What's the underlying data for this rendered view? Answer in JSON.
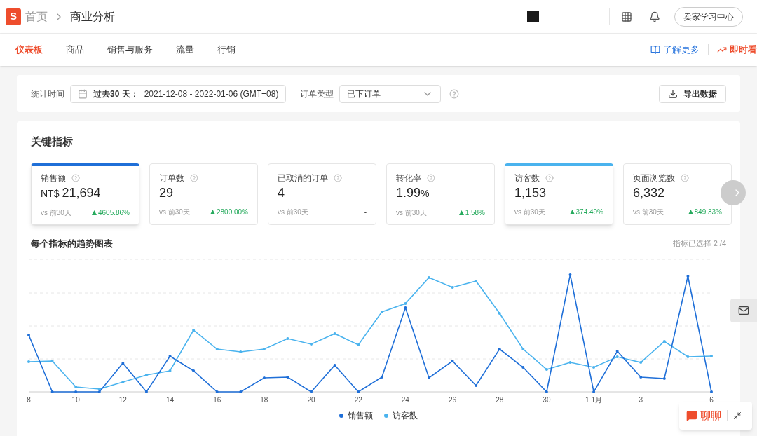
{
  "header": {
    "logo_letter": "S",
    "breadcrumb": [
      {
        "label": "首页"
      },
      {
        "label": "商业分析"
      }
    ],
    "learning_button": "卖家学习中心"
  },
  "nav": {
    "tabs": [
      {
        "label": "仪表板",
        "selected": true
      },
      {
        "label": "商品",
        "selected": false
      },
      {
        "label": "销售与服务",
        "selected": false
      },
      {
        "label": "流量",
        "selected": false
      },
      {
        "label": "行销",
        "selected": false
      }
    ],
    "learn_more": "了解更多",
    "realtime": "即时看"
  },
  "filters": {
    "time_label": "统计时间",
    "time_range_bold": "过去30 天：",
    "time_range": "2021-12-08 - 2022-01-06 (GMT+08)",
    "order_type_label": "订单类型",
    "order_type": "已下订单",
    "export_button": "导出数据"
  },
  "key_metrics": {
    "title": "关键指标",
    "cards": [
      {
        "label": "销售额",
        "prefix": "NT$",
        "value": "21,694",
        "compare": "vs 前30天",
        "change": "4605.86%",
        "rising": true,
        "selected": true,
        "color": "#1f6fd8"
      },
      {
        "label": "订单数",
        "value": "29",
        "compare": "vs 前30天",
        "change": "2800.00%",
        "rising": true,
        "selected": false
      },
      {
        "label": "已取消的订单",
        "value": "4",
        "compare": "vs 前30天",
        "change": "-",
        "rising": false,
        "selected": false
      },
      {
        "label": "转化率",
        "value": "1.99",
        "suffix": "%",
        "compare": "vs 前30天",
        "change": "1.58%",
        "rising": true,
        "selected": false
      },
      {
        "label": "访客数",
        "value": "1,153",
        "compare": "vs 前30天",
        "change": "374.49%",
        "rising": true,
        "selected": true,
        "color": "#4ab3ee"
      },
      {
        "label": "页面浏览数",
        "value": "6,332",
        "compare": "vs 前30天",
        "change": "849.33%",
        "rising": true,
        "selected": false
      }
    ]
  },
  "trend_chart": {
    "title": "每个指标的趋势图表",
    "selection_count": "指标已选择 2 /4",
    "x_labels": [
      "8",
      "10",
      "12",
      "14",
      "16",
      "18",
      "20",
      "22",
      "24",
      "26",
      "28",
      "30",
      "1 1月",
      "3",
      "6"
    ],
    "legend": [
      {
        "label": "销售额",
        "color": "#1f6fd8"
      },
      {
        "label": "访客数",
        "color": "#4ab3ee"
      }
    ]
  },
  "chat": {
    "label": "聊聊"
  }
}
